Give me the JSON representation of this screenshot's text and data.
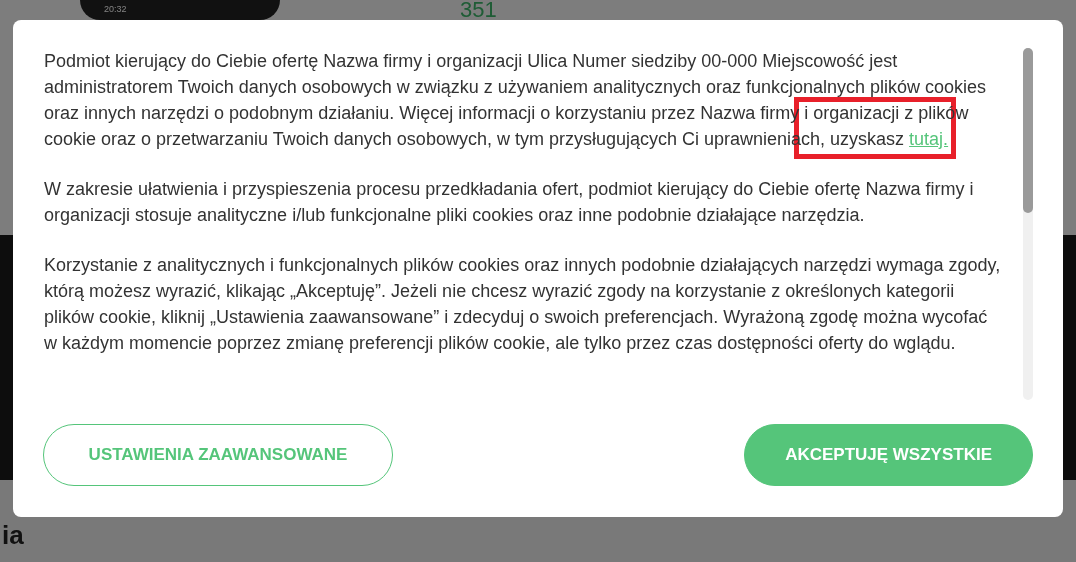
{
  "background": {
    "phone_time": "20:32",
    "counter": "351",
    "heading": "ia"
  },
  "dialog": {
    "paragraphs": [
      {
        "text": "Podmiot kierujący do Ciebie ofertę Nazwa firmy i organizacji Ulica Numer siedziby 00-000 Miejscowość jest administratorem Twoich danych osobowych w związku z używaniem analitycznych oraz funkcjonalnych plików cookies oraz innych narzędzi o podobnym działaniu. Więcej informacji o korzystaniu przez Nazwa firmy i organizacji z plików cookie oraz o przetwarzaniu Twoich danych osobowych, w tym przysługujących Ci uprawnieniach, uzyskasz ",
        "link": "tutaj."
      },
      {
        "text": "W zakresie ułatwienia i przyspieszenia procesu przedkładania ofert, podmiot kierujący do Ciebie ofertę Nazwa firmy i organizacji stosuje analityczne i/lub funkcjonalne pliki cookies oraz inne podobnie działające narzędzia."
      },
      {
        "text": "Korzystanie z analitycznych i funkcjonalnych plików cookies oraz innych podobnie działających narzędzi wymaga zgody, którą możesz wyrazić, klikając „Akceptuję”. Jeżeli nie chcesz wyrazić zgody na korzystanie z określonych kategorii plików cookie, kliknij „Ustawienia zaawansowane” i zdecyduj o swoich preferencjach. Wyrażoną zgodę można wycofać w każdym momencie poprzez zmianę preferencji plików cookie, ale tylko przez czas dostępności oferty do wglądu."
      }
    ],
    "buttons": [
      {
        "label": "USTAWIENIA ZAAWANSOWANE",
        "kind": "outline"
      },
      {
        "label": "AKCEPTUJĘ WSZYSTKIE",
        "kind": "filled"
      }
    ]
  }
}
